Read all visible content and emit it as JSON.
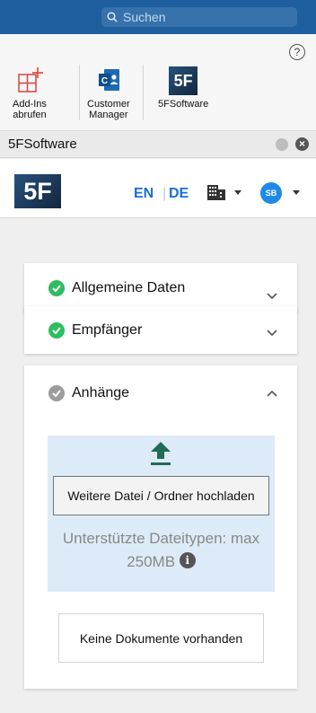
{
  "titlebar": {
    "search_placeholder": "Suchen"
  },
  "ribbon": {
    "help_symbol": "?",
    "buttons": [
      {
        "label_line1": "Add-Ins",
        "label_line2": "abrufen",
        "icon": "add-ins-icon"
      },
      {
        "label_line1": "Customer",
        "label_line2": "Manager",
        "icon": "customer-manager-icon"
      },
      {
        "label_line1": "5FSoftware",
        "label_line2": "",
        "icon": "5f-logo-icon"
      }
    ]
  },
  "pane": {
    "title": "5FSoftware"
  },
  "app": {
    "logo_text": "5F",
    "lang_en": "EN",
    "lang_separator": "|",
    "lang_de": "DE",
    "avatar_initials": "SB"
  },
  "sections": [
    {
      "title": "Allgemeine Daten",
      "complete": true,
      "expanded": false
    },
    {
      "title": "Empfänger",
      "complete": true,
      "expanded": false
    },
    {
      "title": "Anhänge",
      "complete": false,
      "expanded": true
    }
  ],
  "attachments": {
    "upload_label": "Weitere Datei / Ordner hochladen",
    "types_line1": "Unterstützte Dateitypen: max",
    "types_line2": "250MB",
    "empty_label": "Keine Dokumente vorhanden"
  },
  "colors": {
    "accent_blue": "#1a6fd0",
    "title_bar": "#1f5f9e",
    "check_green": "#2ebd5f",
    "check_gray": "#9c9c9c",
    "dropzone_bg": "#dcebf7",
    "upload_arrow": "#1f6b57"
  }
}
